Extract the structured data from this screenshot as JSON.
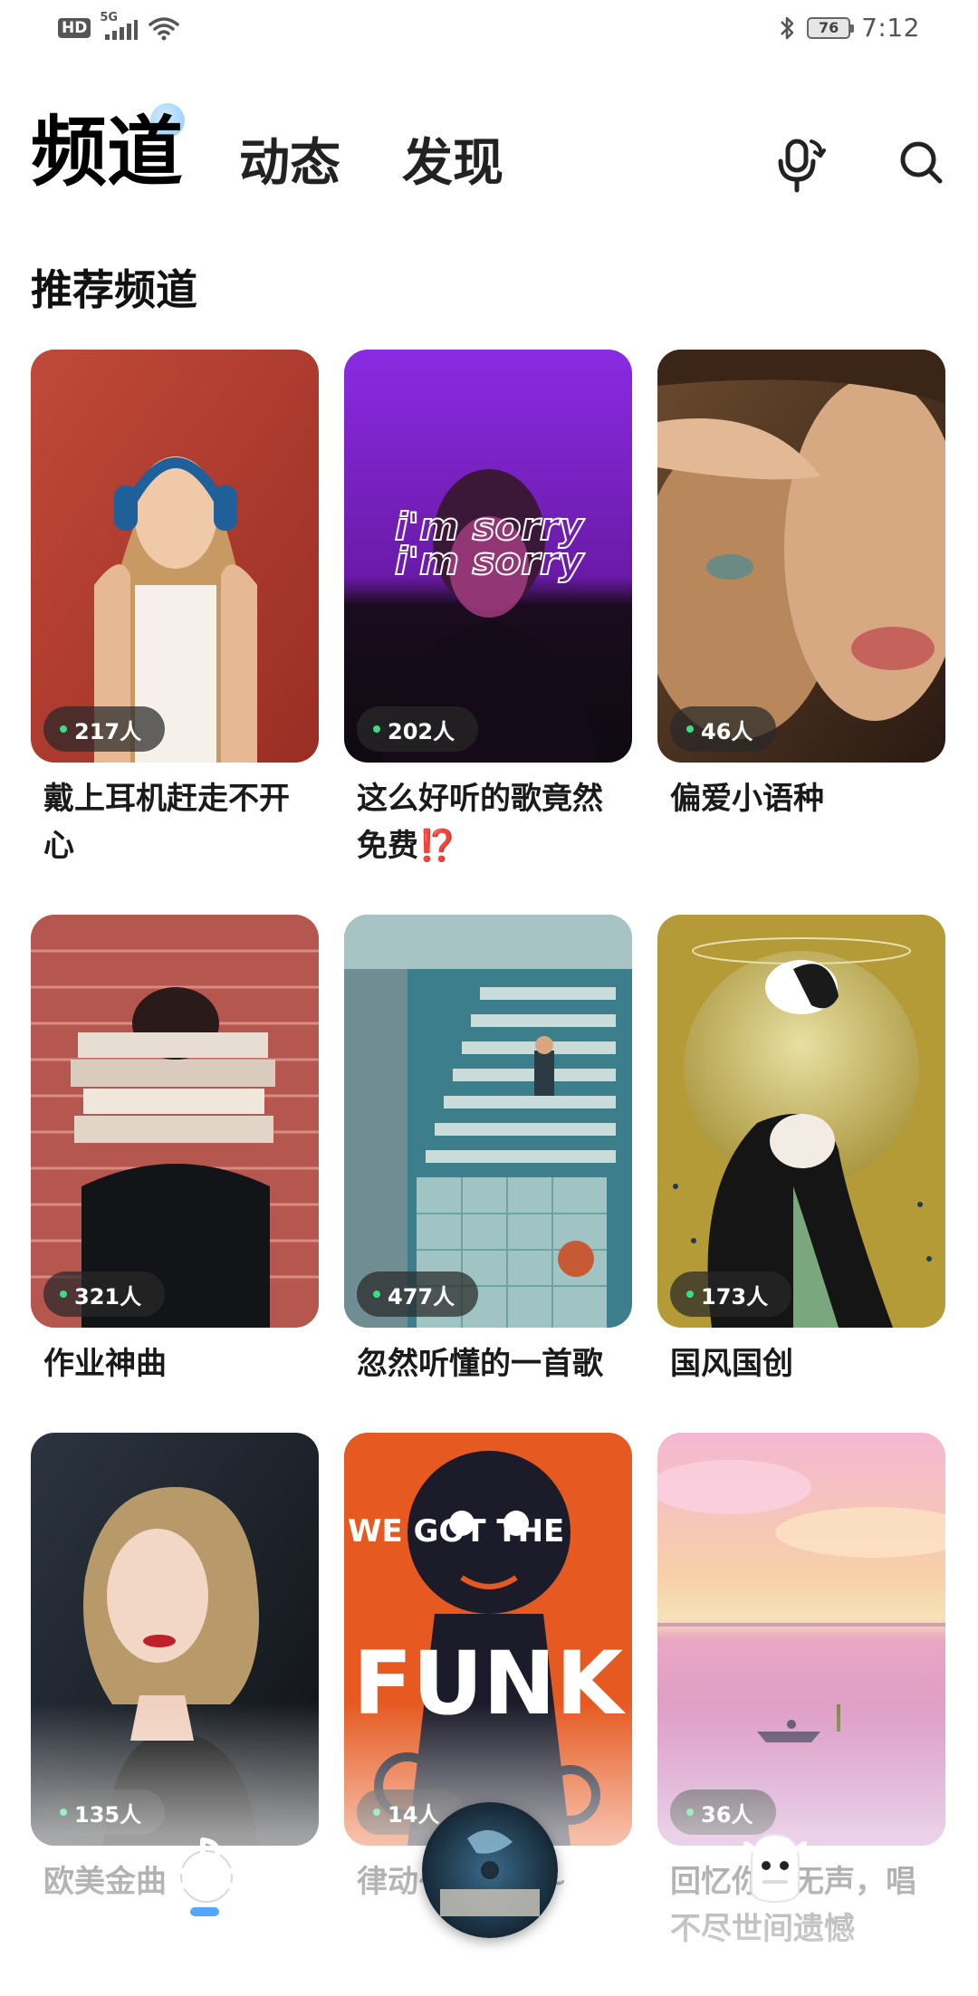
{
  "status_bar": {
    "hd": "HD",
    "network": "5G",
    "battery": "76",
    "time": "7:12"
  },
  "nav": {
    "tabs": [
      {
        "label": "频道",
        "active": true
      },
      {
        "label": "动态",
        "active": false
      },
      {
        "label": "发现",
        "active": false
      }
    ],
    "icons": [
      "mic-refresh-icon",
      "search-icon"
    ]
  },
  "section": {
    "title": "推荐频道"
  },
  "channels": [
    {
      "count": "217人",
      "title": "戴上耳机赶走不开心"
    },
    {
      "count": "202人",
      "title": "这么好听的歌竟然免费⁉️"
    },
    {
      "count": "46人",
      "title": "偏爱小语种"
    },
    {
      "count": "321人",
      "title": "作业神曲"
    },
    {
      "count": "477人",
      "title": "忽然听懂的一首歌"
    },
    {
      "count": "173人",
      "title": "国风国创"
    },
    {
      "count": "135人",
      "title": "欧美金曲"
    },
    {
      "count": "14人",
      "title": "律动～到天亮~"
    },
    {
      "count": "36人",
      "title": "回忆你～无声，唱不尽世间遗憾"
    }
  ],
  "cover_art": {
    "c2_text": "i'm sorry",
    "c8_text": "FUNK",
    "c8_text2": "WE GOT THE"
  },
  "bottom_bar": {
    "icons": [
      "planet-music-icon",
      "now-playing-disc",
      "robot-icon"
    ]
  },
  "colors": {
    "accent": "#53a7ff",
    "online_dot": "#3ddc84",
    "pill_bg": "rgba(40,40,40,0.72)"
  }
}
